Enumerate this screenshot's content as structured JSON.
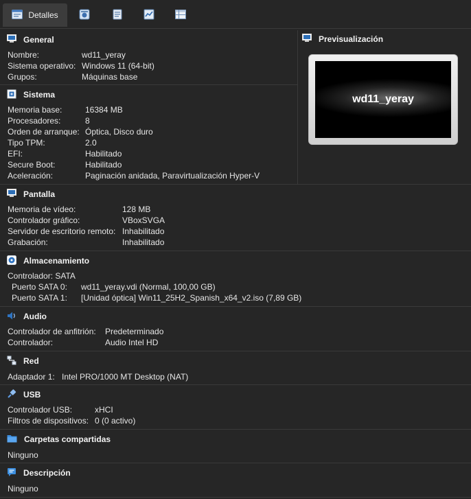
{
  "toolbar": {
    "tabs": [
      {
        "label": "Detalles",
        "icon": "details-icon",
        "active": true
      },
      {
        "label": "",
        "icon": "snapshots-icon"
      },
      {
        "label": "",
        "icon": "logs-icon"
      },
      {
        "label": "",
        "icon": "activity-icon"
      },
      {
        "label": "",
        "icon": "properties-icon"
      }
    ]
  },
  "general": {
    "title": "General",
    "rows": [
      {
        "k": "Nombre:",
        "v": "wd11_yeray"
      },
      {
        "k": "Sistema operativo:",
        "v": "Windows 11 (64-bit)"
      },
      {
        "k": "Grupos:",
        "v": "Máquinas base"
      }
    ]
  },
  "sistema": {
    "title": "Sistema",
    "rows": [
      {
        "k": "Memoria base:",
        "v": "16384 MB"
      },
      {
        "k": "Procesadores:",
        "v": "8"
      },
      {
        "k": "Orden de arranque:",
        "v": "Óptica, Disco duro"
      },
      {
        "k": "Tipo TPM:",
        "v": "2.0"
      },
      {
        "k": "EFI:",
        "v": "Habilitado"
      },
      {
        "k": "Secure Boot:",
        "v": "Habilitado"
      },
      {
        "k": "Aceleración:",
        "v": "Paginación anidada, Paravirtualización Hyper-V"
      }
    ]
  },
  "preview": {
    "title": "Previsualización",
    "screen_text": "wd11_yeray"
  },
  "pantalla": {
    "title": "Pantalla",
    "rows": [
      {
        "k": "Memoria de vídeo:",
        "v": "128 MB"
      },
      {
        "k": "Controlador gráfico:",
        "v": "VBoxSVGA"
      },
      {
        "k": "Servidor de escritorio remoto:",
        "v": "Inhabilitado"
      },
      {
        "k": "Grabación:",
        "v": "Inhabilitado"
      }
    ]
  },
  "almacenamiento": {
    "title": "Almacenamiento",
    "controller": "Controlador: SATA",
    "rows": [
      {
        "k": "Puerto SATA 0:",
        "v": "wd11_yeray.vdi (Normal, 100,00 GB)"
      },
      {
        "k": "Puerto SATA 1:",
        "v": "[Unidad óptica] Win11_25H2_Spanish_x64_v2.iso (7,89 GB)"
      }
    ]
  },
  "audio": {
    "title": "Audio",
    "rows": [
      {
        "k": "Controlador de anfitrión:",
        "v": "Predeterminado"
      },
      {
        "k": "Controlador:",
        "v": "Audio Intel HD"
      }
    ]
  },
  "red": {
    "title": "Red",
    "rows": [
      {
        "k": "Adaptador 1:",
        "v": "Intel PRO/1000 MT Desktop (NAT)"
      }
    ]
  },
  "usb": {
    "title": "USB",
    "rows": [
      {
        "k": "Controlador USB:",
        "v": "xHCI"
      },
      {
        "k": "Filtros de dispositivos:",
        "v": "0 (0 activo)"
      }
    ]
  },
  "carpetas": {
    "title": "Carpetas compartidas",
    "value": "Ninguno"
  },
  "descripcion": {
    "title": "Descripción",
    "value": "Ninguno"
  },
  "colors": {
    "background": "#262626",
    "accent": "#2d8fd6",
    "separator": "#3a3a3a"
  }
}
